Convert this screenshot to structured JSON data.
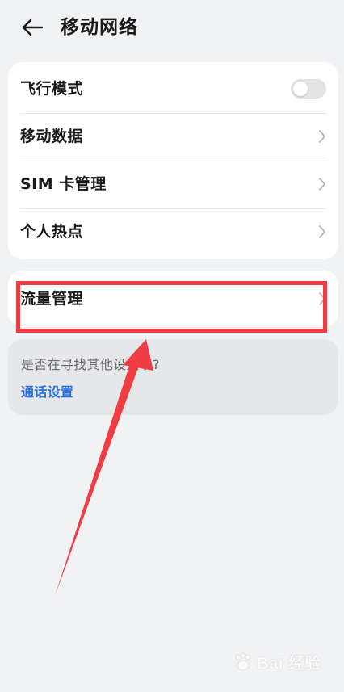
{
  "header": {
    "title": "移动网络",
    "back_icon": "back-arrow-icon"
  },
  "main_section": {
    "items": [
      {
        "label": "飞行模式",
        "control": "toggle",
        "toggle_on": false
      },
      {
        "label": "移动数据",
        "control": "chevron"
      },
      {
        "label": "SIM 卡管理",
        "control": "chevron"
      },
      {
        "label": "个人热点",
        "control": "chevron"
      }
    ]
  },
  "traffic_section": {
    "items": [
      {
        "label": "流量管理",
        "control": "chevron"
      }
    ]
  },
  "suggestion": {
    "question": "是否在寻找其他设置项?",
    "link": "通话设置"
  },
  "watermark": {
    "text": "Bai 经验"
  },
  "colors": {
    "background": "#f1f2f4",
    "card": "#ffffff",
    "suggest_card": "#e6e7ea",
    "link": "#2a6fdb",
    "annotation": "#ef3d43",
    "toggle_off": "#e3e3e5"
  }
}
